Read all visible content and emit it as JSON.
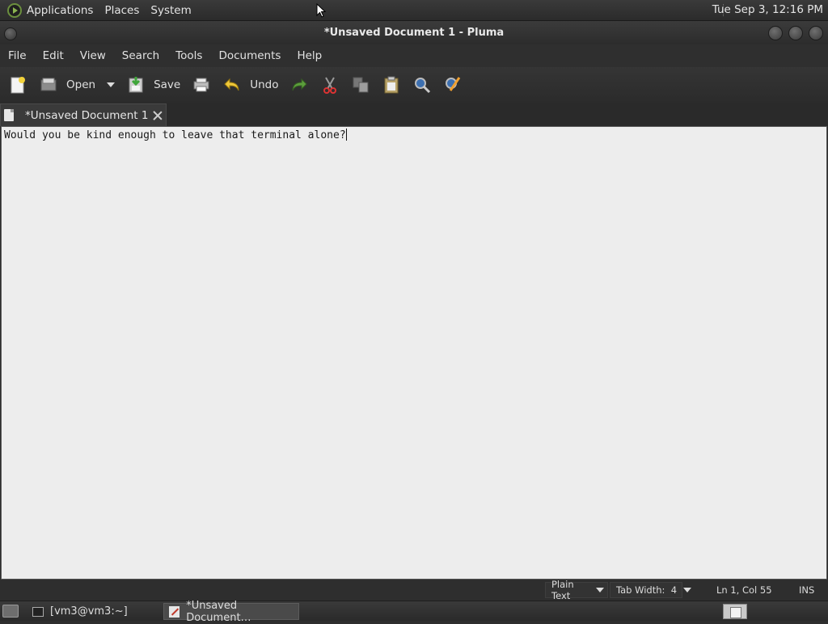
{
  "top_panel": {
    "menus": [
      "Applications",
      "Places",
      "System"
    ],
    "clock": "Tue Sep  3, 12:16 PM"
  },
  "window": {
    "title": "*Unsaved Document 1 - Pluma"
  },
  "menubar": {
    "items": [
      "File",
      "Edit",
      "View",
      "Search",
      "Tools",
      "Documents",
      "Help"
    ]
  },
  "toolbar": {
    "new_icon": "new-document-icon",
    "open_label": "Open",
    "save_label": "Save",
    "print_icon": "printer-icon",
    "undo_label": "Undo",
    "redo_icon": "redo-icon",
    "cut_icon": "scissors-icon",
    "copy_icon": "copy-icon",
    "paste_icon": "clipboard-icon",
    "find_icon": "magnifier-icon",
    "replace_icon": "find-replace-icon"
  },
  "tab": {
    "label": "*Unsaved Document 1"
  },
  "editor": {
    "text": "Would you be kind enough to leave that terminal alone?"
  },
  "statusbar": {
    "language": "Plain Text",
    "tab_width": "Tab Width:  4",
    "cursor_position": "Ln 1, Col 55",
    "mode": "INS"
  },
  "taskbar": {
    "tasks": [
      {
        "label": "[vm3@vm3:~]",
        "icon": "terminal-icon"
      },
      {
        "label": "*Unsaved Document…",
        "icon": "pluma-icon"
      }
    ]
  },
  "colors": {
    "panel_bg": "#2e2e2e",
    "editor_bg": "#ededed",
    "accent_green": "#6b8f3e"
  }
}
